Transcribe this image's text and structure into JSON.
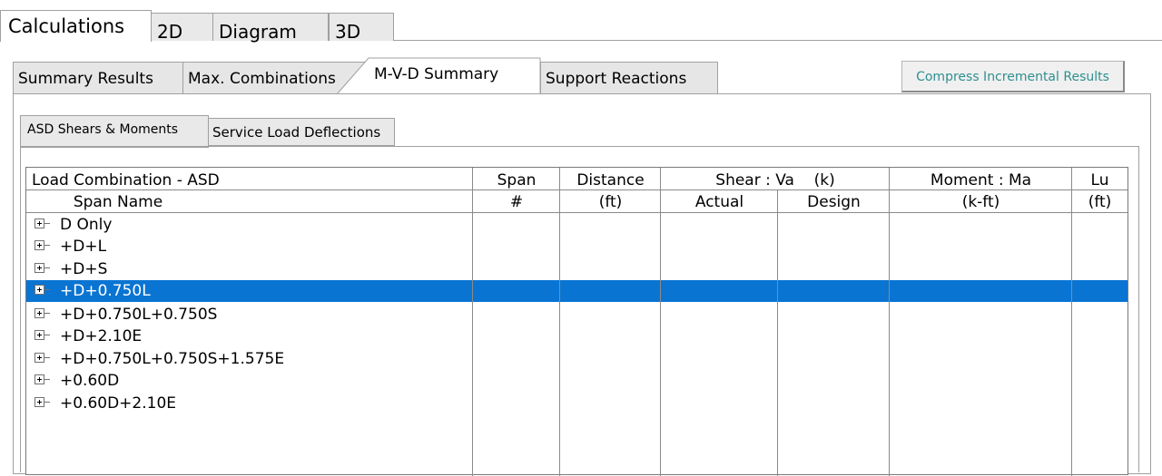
{
  "top_tabs": [
    "Calculations",
    "2D",
    "Diagram",
    "3D"
  ],
  "result_tabs": [
    "Summary Results",
    "Max. Combinations",
    "M-V-D Summary",
    "Support Reactions"
  ],
  "compress_button": "Compress Incremental Results",
  "sub_tabs": [
    "ASD Shears & Moments",
    "Service Load Deflections"
  ],
  "grid": {
    "header_row1": {
      "load_combination": "Load Combination - ASD",
      "span": "Span",
      "distance": "Distance",
      "shear": "Shear : Va    (k)",
      "moment": "Moment : Ma",
      "lu": "Lu"
    },
    "header_row2": {
      "span_name": "Span Name",
      "span_num": "#",
      "distance_unit": "(ft)",
      "actual": "Actual",
      "design": "Design",
      "moment_unit": "(k-ft)",
      "lu_unit": "(ft)"
    },
    "rows": [
      "D Only",
      "+D+L",
      "+D+S",
      "+D+0.750L",
      "+D+0.750L+0.750S",
      "+D+2.10E",
      "+D+0.750L+0.750S+1.575E",
      "+0.60D",
      "+0.60D+2.10E"
    ],
    "selected_row": "+D+0.750L"
  }
}
